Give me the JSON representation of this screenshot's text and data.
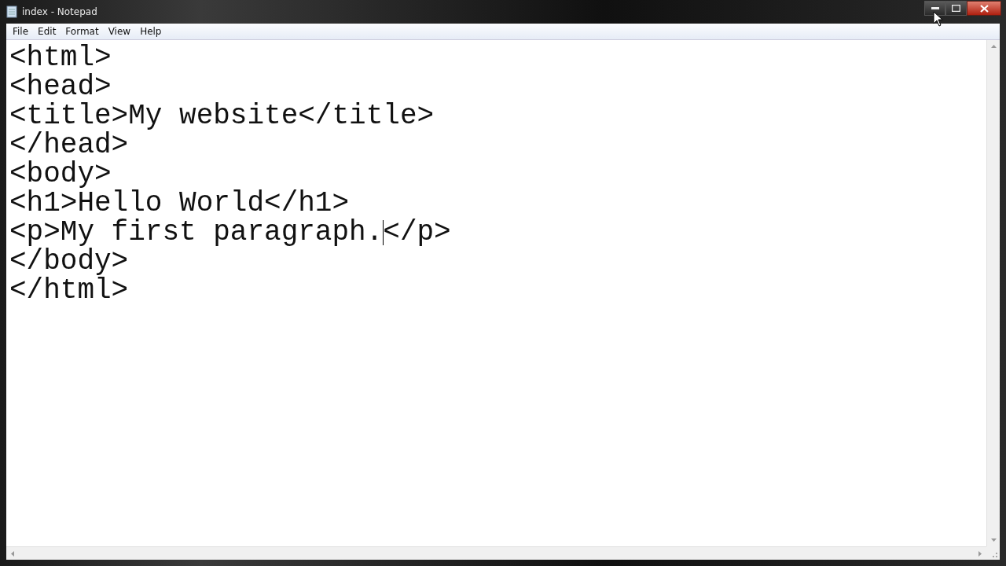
{
  "window": {
    "title": "index - Notepad"
  },
  "menu": [
    "File",
    "Edit",
    "Format",
    "View",
    "Help"
  ],
  "editor": {
    "lines": [
      {
        "kind": "plain",
        "text": "<html>"
      },
      {
        "kind": "plain",
        "text": "<head>"
      },
      {
        "kind": "plain",
        "text": "<title>My website</title>"
      },
      {
        "kind": "plain",
        "text": "</head>"
      },
      {
        "kind": "plain",
        "text": "<body>"
      },
      {
        "kind": "plain",
        "text": "<h1>Hello World</h1>"
      },
      {
        "kind": "caret",
        "before": "<p>My first paragraph.",
        "after": "</p>"
      },
      {
        "kind": "plain",
        "text": "</body>"
      },
      {
        "kind": "plain",
        "text": "</html>"
      }
    ]
  }
}
